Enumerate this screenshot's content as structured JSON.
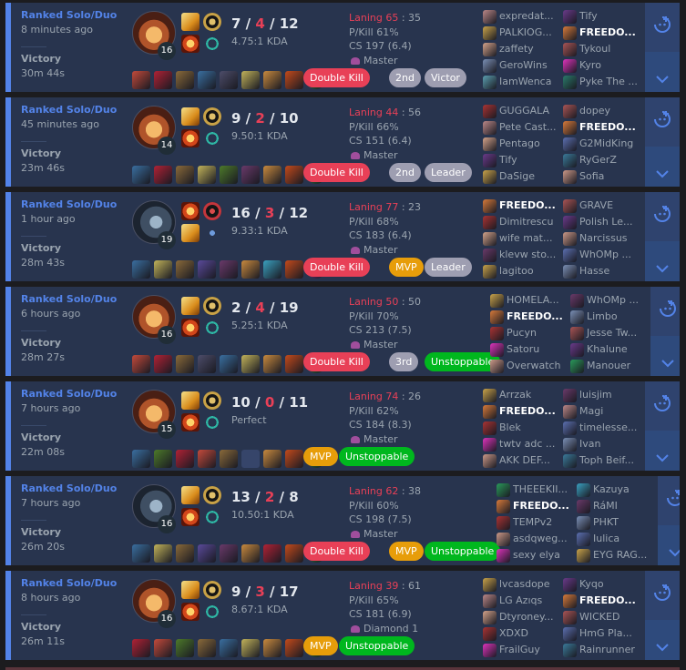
{
  "matches": [
    {
      "queue": "Ranked Solo/Duo",
      "ago": "8 minutes ago",
      "result": "Victory",
      "duration": "30m 44s",
      "champion_icon": "champion-portrait",
      "champ_style": "c0",
      "level": "16",
      "spells": [
        "flash",
        "ignite"
      ],
      "runes": [
        "conq",
        "res"
      ],
      "kills": "7",
      "deaths": "4",
      "assists": "12",
      "ratio": "4.75:1 KDA",
      "items": [
        "#c44a3b",
        "#b12235",
        "#8a6a3a",
        "#3a6fa0",
        "#4d4d6a",
        "#c2b35a",
        "#c98a3e",
        "#c44a1b",
        "#2e8a43"
      ],
      "badges": [
        {
          "label": "Double Kill",
          "style": "red"
        },
        {
          "label": "2nd",
          "style": "gray"
        },
        {
          "label": "Victor",
          "style": "gray"
        }
      ],
      "laning": "Laning 65",
      "laning_score": " : 35",
      "pkill": "P/Kill 61%",
      "cs": "CS 197 (6.4)",
      "tier": "Master",
      "team1": [
        {
          "name": "expredat...",
          "color": "#b88"
        },
        {
          "name": "PALKIOG...",
          "color": "#c9a34a"
        },
        {
          "name": "zaffety",
          "color": "#d4a38a"
        },
        {
          "name": "GeroWins",
          "color": "#7a8fb5"
        },
        {
          "name": "IamWenca",
          "color": "#5b9fb0"
        }
      ],
      "team2": [
        {
          "name": "Tify",
          "color": "#6a3a8a"
        },
        {
          "name": "FREEDO...",
          "color": "#d77a3a",
          "me": true
        },
        {
          "name": "Tykoul",
          "color": "#a55"
        },
        {
          "name": "Kyro",
          "color": "#d3b"
        },
        {
          "name": "Pyke The ...",
          "color": "#2a7a6a"
        }
      ],
      "me_team": 2
    },
    {
      "queue": "Ranked Solo/Duo",
      "ago": "45 minutes ago",
      "result": "Victory",
      "duration": "23m 46s",
      "champion_icon": "champion-portrait",
      "champ_style": "c0",
      "level": "14",
      "spells": [
        "flash",
        "ignite"
      ],
      "runes": [
        "conq",
        "res"
      ],
      "kills": "9",
      "deaths": "2",
      "assists": "10",
      "ratio": "9.50:1 KDA",
      "items": [
        "#3a6fa0",
        "#b12235",
        "#8a6a3a",
        "#c2b35a",
        "#4d7a2a",
        "#6a3a6a",
        "#c98a3e",
        "#c44a1b",
        "#2e8a43"
      ],
      "badges": [
        {
          "label": "Double Kill",
          "style": "red"
        },
        {
          "label": "2nd",
          "style": "gray"
        },
        {
          "label": "Leader",
          "style": "gray"
        }
      ],
      "laning": "Laning 44",
      "laning_score": " : 56",
      "pkill": "P/Kill 66%",
      "cs": "CS 151 (6.4)",
      "tier": "Master",
      "team1": [
        {
          "name": "GUGGALA",
          "color": "#a33"
        },
        {
          "name": "Pete Cast...",
          "color": "#b88"
        },
        {
          "name": "Pentago",
          "color": "#d4a38a"
        },
        {
          "name": "Tify",
          "color": "#6a3a8a"
        },
        {
          "name": "DaSige",
          "color": "#c9a34a"
        }
      ],
      "team2": [
        {
          "name": "dopey",
          "color": "#a55"
        },
        {
          "name": "FREEDO...",
          "color": "#d77a3a",
          "me": true
        },
        {
          "name": "G2MidKing",
          "color": "#5b6fb0"
        },
        {
          "name": "RyGerZ",
          "color": "#3a7a9a"
        },
        {
          "name": "Sofia",
          "color": "#c98"
        }
      ],
      "me_team": 2
    },
    {
      "queue": "Ranked Solo/Duo",
      "ago": "1 hour ago",
      "result": "Victory",
      "duration": "28m 43s",
      "champion_icon": "champion-portrait",
      "champ_style": "c1",
      "level": "19",
      "spells": [
        "ignite",
        "flash"
      ],
      "runes": [
        "elec",
        "sorc"
      ],
      "kills": "16",
      "deaths": "3",
      "assists": "12",
      "ratio": "9.33:1 KDA",
      "items": [
        "#3a6fa0",
        "#c2b35a",
        "#8a6a3a",
        "#5a4a9a",
        "#6a3a6a",
        "#c98a3e",
        "#3aa0c0",
        "#c44a1b",
        "#8a3a9a"
      ],
      "badges": [
        {
          "label": "Double Kill",
          "style": "red"
        },
        {
          "label": "MVP",
          "style": "gold"
        },
        {
          "label": "Leader",
          "style": "gray"
        }
      ],
      "laning": "Laning 77",
      "laning_score": " : 23",
      "pkill": "P/Kill 68%",
      "cs": "CS 183 (6.4)",
      "tier": "Master",
      "team1": [
        {
          "name": "FREEDO...",
          "color": "#d77a3a",
          "me": true
        },
        {
          "name": "Dimitrescu",
          "color": "#a33"
        },
        {
          "name": "wife mat...",
          "color": "#d4a38a"
        },
        {
          "name": "klevw sto...",
          "color": "#6a3a6a"
        },
        {
          "name": "lagitoo",
          "color": "#c9a34a"
        }
      ],
      "team2": [
        {
          "name": "GRAVE",
          "color": "#a55"
        },
        {
          "name": "Polish Le...",
          "color": "#6a3a8a"
        },
        {
          "name": "Narcissus",
          "color": "#c98"
        },
        {
          "name": "WhOMp ...",
          "color": "#5b6fb0"
        },
        {
          "name": "Hasse",
          "color": "#7a8fb5"
        }
      ],
      "me_team": 1
    },
    {
      "queue": "Ranked Solo/Duo",
      "ago": "6 hours ago",
      "result": "Victory",
      "duration": "28m 27s",
      "champion_icon": "champion-portrait",
      "champ_style": "c0",
      "level": "16",
      "spells": [
        "flash",
        "ignite"
      ],
      "runes": [
        "conq",
        "res"
      ],
      "kills": "2",
      "deaths": "4",
      "assists": "19",
      "ratio": "5.25:1 KDA",
      "items": [
        "#c44a3b",
        "#b12235",
        "#8a6a3a",
        "#4d4d6a",
        "#3a6fa0",
        "#c2b35a",
        "#c98a3e",
        "#c44a1b",
        "#2e8a43"
      ],
      "badges": [
        {
          "label": "Double Kill",
          "style": "red"
        },
        {
          "label": "3rd",
          "style": "gray"
        },
        {
          "label": "Unstoppable",
          "style": "green"
        }
      ],
      "laning": "Laning 50",
      "laning_score": " : 50",
      "pkill": "P/Kill 70%",
      "cs": "CS 213 (7.5)",
      "tier": "Master",
      "team1": [
        {
          "name": "HOMELA...",
          "color": "#c9a34a"
        },
        {
          "name": "FREEDO...",
          "color": "#d77a3a",
          "me": true
        },
        {
          "name": "Pucyn",
          "color": "#a33"
        },
        {
          "name": "Satoru",
          "color": "#d3b"
        },
        {
          "name": "Overwatch",
          "color": "#c98"
        }
      ],
      "team2": [
        {
          "name": "WhOMp ...",
          "color": "#6a3a6a"
        },
        {
          "name": "Limbo",
          "color": "#7a8fb5"
        },
        {
          "name": "Jesse Tw...",
          "color": "#a55"
        },
        {
          "name": "Khalune",
          "color": "#6a3a8a"
        },
        {
          "name": "Manouer",
          "color": "#2a9a5a"
        }
      ],
      "me_team": 1
    },
    {
      "queue": "Ranked Solo/Duo",
      "ago": "7 hours ago",
      "result": "Victory",
      "duration": "22m 08s",
      "champion_icon": "champion-portrait",
      "champ_style": "c0",
      "level": "15",
      "spells": [
        "flash",
        "ignite"
      ],
      "runes": [
        "conq",
        "res"
      ],
      "kills": "10",
      "deaths": "0",
      "assists": "11",
      "ratio": "Perfect",
      "items": [
        "#3a6fa0",
        "#4d7a2a",
        "#b12235",
        "#c44a3b",
        "#8a6a3a",
        "empty",
        "#c98a3e",
        "#c44a1b",
        "#2e8a43"
      ],
      "badges": [
        {
          "label": "MVP",
          "style": "gold"
        },
        {
          "label": "Unstoppable",
          "style": "green"
        }
      ],
      "laning": "Laning 74",
      "laning_score": " : 26",
      "pkill": "P/Kill 62%",
      "cs": "CS 184 (8.3)",
      "tier": "Master",
      "team1": [
        {
          "name": "Arrzak",
          "color": "#c9a34a"
        },
        {
          "name": "FREEDO...",
          "color": "#d77a3a",
          "me": true
        },
        {
          "name": "Blek",
          "color": "#a33"
        },
        {
          "name": "twtv adc ...",
          "color": "#d3b"
        },
        {
          "name": "AKK DEF...",
          "color": "#c98"
        }
      ],
      "team2": [
        {
          "name": "luisjim",
          "color": "#6a3a6a"
        },
        {
          "name": "Magi",
          "color": "#b88"
        },
        {
          "name": "timelesse...",
          "color": "#5b6fb0"
        },
        {
          "name": "Ivan",
          "color": "#7a8fb5"
        },
        {
          "name": "Toph Beif...",
          "color": "#3a7a9a"
        }
      ],
      "me_team": 1
    },
    {
      "queue": "Ranked Solo/Duo",
      "ago": "7 hours ago",
      "result": "Victory",
      "duration": "26m 20s",
      "champion_icon": "champion-portrait",
      "champ_style": "c1",
      "level": "16",
      "spells": [
        "flash",
        "ignite"
      ],
      "runes": [
        "conq",
        "res"
      ],
      "kills": "13",
      "deaths": "2",
      "assists": "8",
      "ratio": "10.50:1 KDA",
      "items": [
        "#3a6fa0",
        "#c2b35a",
        "#8a6a3a",
        "#5a4a9a",
        "#6a3a6a",
        "#c98a3e",
        "#b12235",
        "#c44a1b",
        "#2e8a43"
      ],
      "badges": [
        {
          "label": "Double Kill",
          "style": "red"
        },
        {
          "label": "MVP",
          "style": "gold"
        },
        {
          "label": "Unstoppable",
          "style": "green"
        }
      ],
      "laning": "Laning 62",
      "laning_score": " : 38",
      "pkill": "P/Kill 60%",
      "cs": "CS 198 (7.5)",
      "tier": "Master",
      "team1": [
        {
          "name": "THEEEKII...",
          "color": "#2a9a5a"
        },
        {
          "name": "FREEDO...",
          "color": "#d77a3a",
          "me": true
        },
        {
          "name": "TEMPv2",
          "color": "#a33"
        },
        {
          "name": "asdqweg...",
          "color": "#c98"
        },
        {
          "name": "sexy elya",
          "color": "#d3b"
        }
      ],
      "team2": [
        {
          "name": "Kazuya",
          "color": "#3aa0c0"
        },
        {
          "name": "RáMI",
          "color": "#6a3a6a"
        },
        {
          "name": "PHKT",
          "color": "#7a8fb5"
        },
        {
          "name": "Iulica",
          "color": "#5b6fb0"
        },
        {
          "name": "EYG RAG...",
          "color": "#c9a34a"
        }
      ],
      "me_team": 1
    },
    {
      "queue": "Ranked Solo/Duo",
      "ago": "8 hours ago",
      "result": "Victory",
      "duration": "26m 11s",
      "champion_icon": "champion-portrait",
      "champ_style": "c0",
      "level": "16",
      "spells": [
        "flash",
        "ignite"
      ],
      "runes": [
        "conq",
        "res"
      ],
      "kills": "9",
      "deaths": "3",
      "assists": "17",
      "ratio": "8.67:1 KDA",
      "items": [
        "#b12235",
        "#c44a3b",
        "#4d7a2a",
        "#8a6a3a",
        "#3a6fa0",
        "#c2b35a",
        "#c98a3e",
        "#c44a1b",
        "#2e8a43"
      ],
      "badges": [
        {
          "label": "MVP",
          "style": "gold"
        },
        {
          "label": "Unstoppable",
          "style": "green"
        }
      ],
      "laning": "Laning 39",
      "laning_score": " : 61",
      "pkill": "P/Kill 65%",
      "cs": "CS 181 (6.9)",
      "tier": "Diamond 1",
      "team1": [
        {
          "name": "lvcasdope",
          "color": "#c9a34a"
        },
        {
          "name": "LG Azıqs",
          "color": "#b88"
        },
        {
          "name": "Dtyroney...",
          "color": "#d4a38a"
        },
        {
          "name": "XDXD",
          "color": "#a33"
        },
        {
          "name": "FrailGuy",
          "color": "#d3b"
        }
      ],
      "team2": [
        {
          "name": "Kyqo",
          "color": "#6a3a8a"
        },
        {
          "name": "FREEDO...",
          "color": "#d77a3a",
          "me": true
        },
        {
          "name": "WICKED",
          "color": "#a55"
        },
        {
          "name": "HmG Pla...",
          "color": "#5b6fb0"
        },
        {
          "name": "Rainrunner",
          "color": "#3a7a9a"
        }
      ],
      "me_team": 2
    }
  ],
  "colors": {
    "win": "#5383e8",
    "loss": "#e84057",
    "card_bg": "#28344e",
    "btn_bg": "#2f436e"
  }
}
